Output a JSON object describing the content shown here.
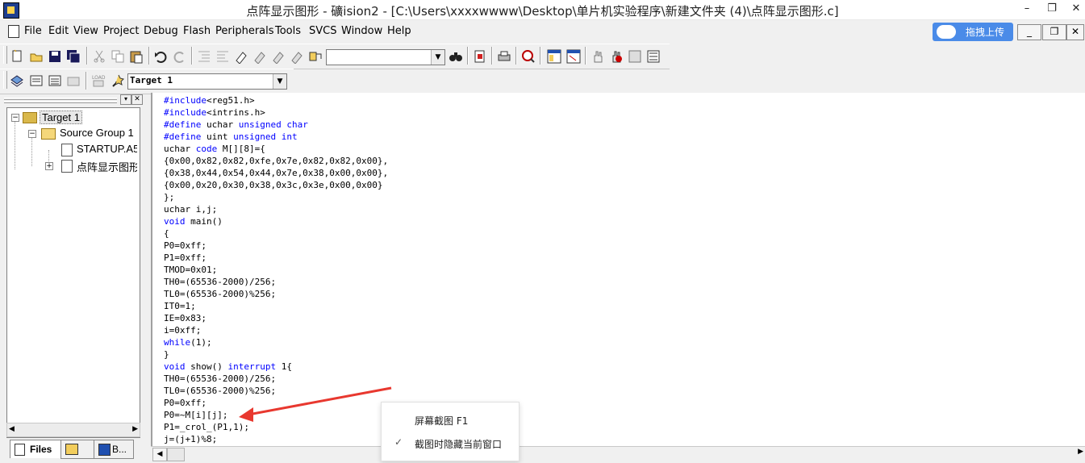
{
  "window": {
    "title": "点阵显示图形 - 礦ision2 - [C:\\Users\\xxxxwwww\\Desktop\\单片机实验程序\\新建文件夹 (4)\\点阵显示图形.c]",
    "min_glyph": "–",
    "max_glyph": "❐",
    "close_glyph": "✕"
  },
  "menu": {
    "items": [
      "File",
      "Edit",
      "View",
      "Project",
      "Debug",
      "Flash",
      "Peripherals",
      "Tools",
      "SVCS",
      "Window",
      "Help"
    ]
  },
  "baidu": {
    "label": "拖拽上传"
  },
  "mdi": {
    "min": "_",
    "restore": "❐",
    "close": "✕"
  },
  "toolbar2": {
    "target_value": "Target 1"
  },
  "project_tree": {
    "root": "Target 1",
    "group": "Source Group 1",
    "files": [
      "STARTUP.A51",
      "点阵显示图形."
    ]
  },
  "tabs": [
    "Files",
    "",
    "B..."
  ],
  "code": [
    "#include<reg51.h>",
    "#include<intrins.h>",
    "#define uchar unsigned char",
    "#define uint unsigned int",
    "uchar code M[][8]={",
    "{0x00,0x82,0x82,0xfe,0x7e,0x82,0x82,0x00},",
    "{0x38,0x44,0x54,0x44,0x7e,0x38,0x00,0x00},",
    "{0x00,0x20,0x30,0x38,0x3c,0x3e,0x00,0x00}",
    "};",
    "uchar i,j;",
    "void main()",
    "{",
    "P0=0xff;",
    "P1=0xff;",
    "TMOD=0x01;",
    "TH0=(65536-2000)/256;",
    "TL0=(65536-2000)%256;",
    "IT0=1;",
    "IE=0x83;",
    "i=0xff;",
    "while(1);",
    "}",
    "void show() interrupt 1{",
    "TH0=(65536-2000)/256;",
    "TL0=(65536-2000)%256;",
    "P0=0xff;",
    "P0=~M[i][j];",
    "P1=_crol_(P1,1);",
    "j=(j+1)%8;"
  ],
  "popup": {
    "item1": "屏幕截图 F1",
    "item2": "截图时隐藏当前窗口",
    "check": "✓"
  },
  "colors": {
    "keyword": "#0000ff",
    "arrow": "#e8382f",
    "baidu": "#4a8be8"
  }
}
